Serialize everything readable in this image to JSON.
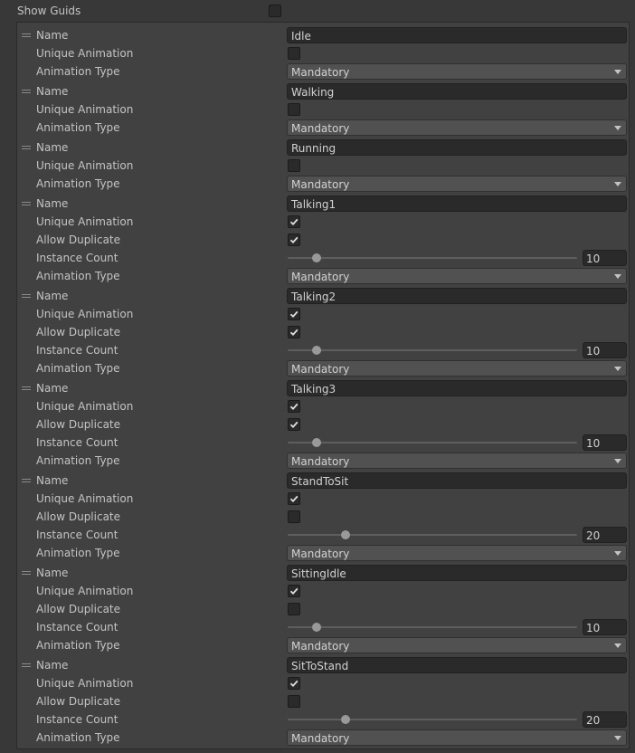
{
  "show_guids": {
    "label": "Show Guids",
    "checked": false
  },
  "labels": {
    "name": "Name",
    "unique": "Unique Animation",
    "allow_duplicate": "Allow Duplicate",
    "instance_count": "Instance Count",
    "animation_type": "Animation Type"
  },
  "slider": {
    "min": 0,
    "max": 100
  },
  "animations": [
    {
      "name": "Idle",
      "unique": false,
      "animation_type": "Mandatory"
    },
    {
      "name": "Walking",
      "unique": false,
      "animation_type": "Mandatory"
    },
    {
      "name": "Running",
      "unique": false,
      "animation_type": "Mandatory"
    },
    {
      "name": "Talking1",
      "unique": true,
      "allow_duplicate": true,
      "instance_count": "10",
      "animation_type": "Mandatory"
    },
    {
      "name": "Talking2",
      "unique": true,
      "allow_duplicate": true,
      "instance_count": "10",
      "animation_type": "Mandatory"
    },
    {
      "name": "Talking3",
      "unique": true,
      "allow_duplicate": true,
      "instance_count": "10",
      "animation_type": "Mandatory"
    },
    {
      "name": "StandToSit",
      "unique": true,
      "allow_duplicate": false,
      "instance_count": "20",
      "animation_type": "Mandatory"
    },
    {
      "name": "SittingIdle",
      "unique": true,
      "allow_duplicate": false,
      "instance_count": "10",
      "animation_type": "Mandatory"
    },
    {
      "name": "SitToStand",
      "unique": true,
      "allow_duplicate": false,
      "instance_count": "20",
      "animation_type": "Mandatory"
    }
  ]
}
